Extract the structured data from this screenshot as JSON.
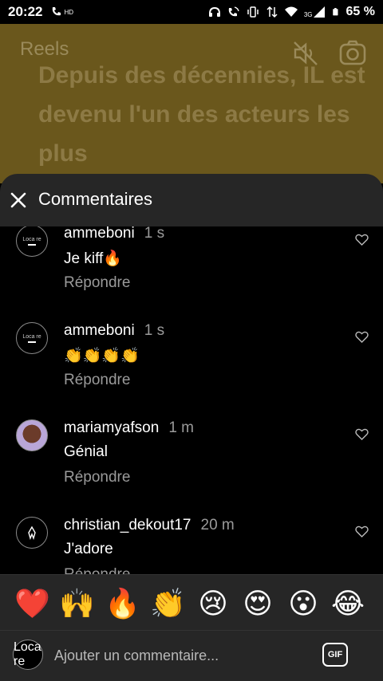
{
  "status_bar": {
    "time": "20:22",
    "call_badge": "HD",
    "network": "3G",
    "battery_pct": "65 %",
    "icons": [
      "phone-hd-icon",
      "headphones-icon",
      "wifi-call-icon",
      "vibrate-icon",
      "data-arrows-icon",
      "wifi-icon",
      "signal-icon",
      "battery-icon"
    ]
  },
  "reel": {
    "label": "Reels",
    "overlay_text": "Depuis des décennies, IL est devenu l'un des acteurs les plus",
    "bg_color": "#6a571c"
  },
  "sheet": {
    "title": "Commentaires",
    "comments": [
      {
        "user": "ammeboni",
        "time": "1 s",
        "text": "Je kiff🔥",
        "reply": "Répondre",
        "avatar_text": "Loca re"
      },
      {
        "user": "ammeboni",
        "time": "1 s",
        "text": "👏👏👏👏",
        "reply": "Répondre",
        "avatar_text": "Loca re"
      },
      {
        "user": "mariamyafson",
        "time": "1 m",
        "text": "Génial",
        "reply": "Répondre",
        "avatar_text": ""
      },
      {
        "user": "christian_dekout17",
        "time": "20 m",
        "text": "J'adore",
        "reply": "Répondre",
        "avatar_text": ""
      }
    ],
    "emojis": [
      "❤️",
      "🙌",
      "🔥",
      "👏",
      "😢",
      "😍",
      "😮",
      "😂"
    ],
    "input": {
      "placeholder": "Ajouter un commentaire...",
      "gif_label": "GIF",
      "avatar_text": "Loca re"
    }
  }
}
